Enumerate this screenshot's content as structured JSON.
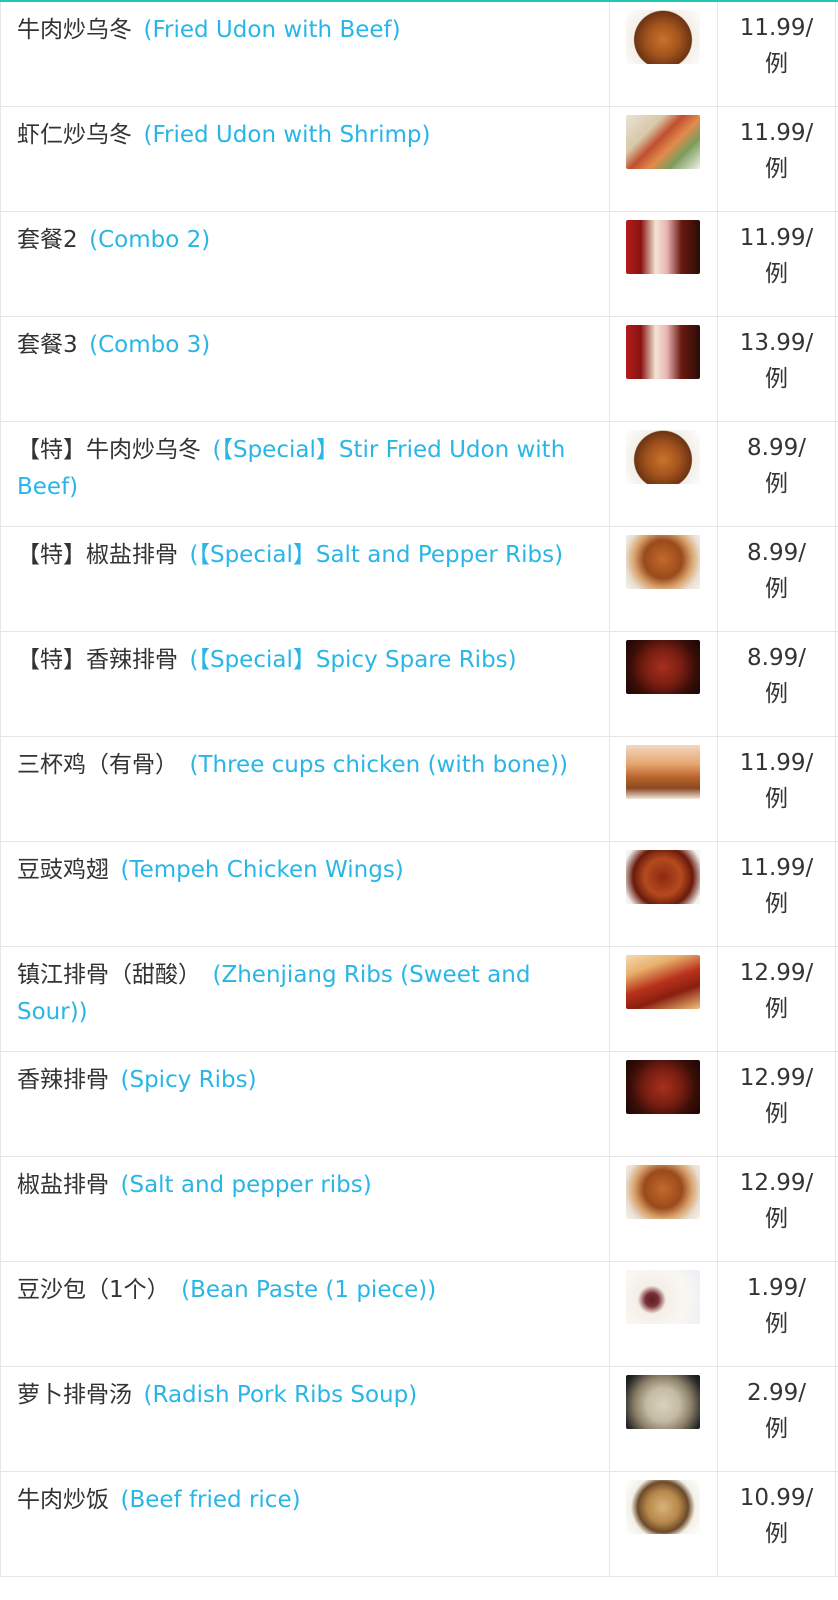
{
  "colors": {
    "accent": "#1ec8b2",
    "english_text": "#29b6e6",
    "chinese_text": "#333333"
  },
  "menu_items": [
    {
      "zh": "牛肉炒乌冬",
      "en": "(Fried Udon with Beef)",
      "price": "11.99/",
      "unit": "例",
      "image": "fried-udon-beef-photo"
    },
    {
      "zh": "虾仁炒乌冬",
      "en": "(Fried Udon with Shrimp)",
      "price": "11.99/",
      "unit": "例",
      "image": "fried-udon-shrimp-photo"
    },
    {
      "zh": "套餐2",
      "en": "(Combo 2)",
      "price": "11.99/",
      "unit": "例",
      "image": "combo-box-photo"
    },
    {
      "zh": "套餐3",
      "en": "(Combo 3)",
      "price": "13.99/",
      "unit": "例",
      "image": "combo-box-photo"
    },
    {
      "zh": "【特】牛肉炒乌冬",
      "en": "(【Special】Stir Fried Udon with Beef)",
      "price": "8.99/",
      "unit": "例",
      "image": "fried-udon-beef-photo"
    },
    {
      "zh": "【特】椒盐排骨",
      "en": "(【Special】Salt and Pepper Ribs)",
      "price": "8.99/",
      "unit": "例",
      "image": "salt-pepper-ribs-photo"
    },
    {
      "zh": "【特】香辣排骨",
      "en": "(【Special】Spicy Spare Ribs)",
      "price": "8.99/",
      "unit": "例",
      "image": "spicy-ribs-photo"
    },
    {
      "zh": "三杯鸡（有骨）",
      "en": "(Three cups chicken (with bone))",
      "price": "11.99/",
      "unit": "例",
      "image": "three-cups-chicken-photo"
    },
    {
      "zh": "豆豉鸡翅",
      "en": "(Tempeh Chicken Wings)",
      "price": "11.99/",
      "unit": "例",
      "image": "chicken-wings-photo"
    },
    {
      "zh": "镇江排骨（甜酸）",
      "en": "(Zhenjiang Ribs (Sweet and Sour))",
      "price": "12.99/",
      "unit": "例",
      "image": "zhenjiang-ribs-photo"
    },
    {
      "zh": "香辣排骨",
      "en": "(Spicy Ribs)",
      "price": "12.99/",
      "unit": "例",
      "image": "spicy-ribs-photo"
    },
    {
      "zh": "椒盐排骨",
      "en": "(Salt and pepper ribs)",
      "price": "12.99/",
      "unit": "例",
      "image": "salt-pepper-ribs-photo"
    },
    {
      "zh": "豆沙包（1个）",
      "en": "(Bean Paste (1 piece))",
      "price": "1.99/",
      "unit": "例",
      "image": "bean-paste-bun-photo"
    },
    {
      "zh": "萝卜排骨汤",
      "en": "(Radish Pork Ribs Soup)",
      "price": "2.99/",
      "unit": "例",
      "image": "radish-soup-photo"
    },
    {
      "zh": "牛肉炒饭",
      "en": "(Beef fried rice)",
      "price": "10.99/",
      "unit": "例",
      "image": "beef-fried-rice-photo"
    }
  ]
}
